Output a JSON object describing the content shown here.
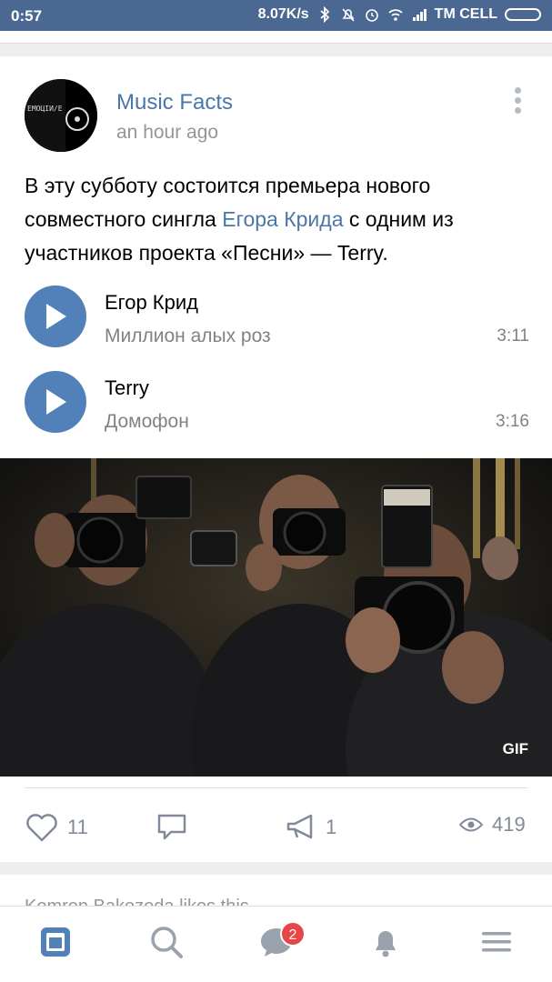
{
  "status_bar": {
    "time": "0:57",
    "network_speed": "8.07K/s",
    "carrier": "TM CELL"
  },
  "post": {
    "author": "Music Facts",
    "time": "an hour ago",
    "text_before": "В эту субботу состоится премьера нового совместного сингла ",
    "text_link": "Егора Крида",
    "text_after": " с одним из участников проекта «Песни» — Terry.",
    "avatar_text": "EMOЦIИ/E",
    "tracks": [
      {
        "artist": "Егор Крид",
        "title": "Миллион алых роз",
        "duration": "3:11"
      },
      {
        "artist": "Terry",
        "title": "Домофон",
        "duration": "3:16"
      }
    ],
    "media_badge": "GIF",
    "likes": "11",
    "shares": "1",
    "views": "419"
  },
  "next_post": {
    "preview": "Komron Bakozoda likes this"
  },
  "tabbar": {
    "messages_badge": "2"
  },
  "colors": {
    "accent": "#4a76a8",
    "status_bar": "#4a6891",
    "play_button": "#5181b8",
    "badge": "#e64646"
  }
}
